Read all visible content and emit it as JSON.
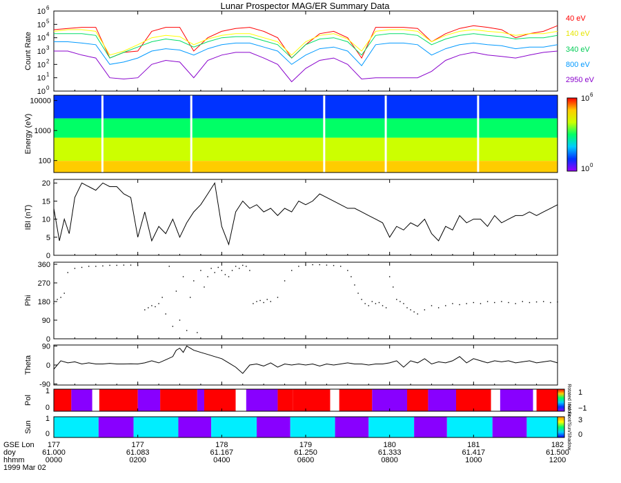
{
  "title": "Lunar Prospector MAG/ER Summary Data",
  "chart_data": [
    {
      "type": "line",
      "panel": "count_rate",
      "ylabel": "Count Rate",
      "yscale": "log",
      "ylim": [
        1,
        1000000
      ],
      "yticks": [
        "10",
        "10",
        "10",
        "10",
        "10",
        "10",
        "10"
      ],
      "ytick_exp": [
        "0",
        "1",
        "2",
        "3",
        "4",
        "5",
        "6"
      ],
      "grid": false,
      "legend_position": "right",
      "x": [
        0,
        20,
        40,
        60,
        80,
        100,
        120,
        140,
        160,
        180,
        200,
        220,
        240,
        260,
        280,
        300,
        320,
        340,
        360,
        380,
        400,
        420,
        440,
        460,
        480,
        500,
        520,
        540,
        560,
        580,
        600,
        620,
        640,
        660,
        680,
        700,
        720
      ],
      "series": [
        {
          "name": "40 eV",
          "color": "#ff0000",
          "values": [
            40000,
            50000,
            60000,
            60000,
            300,
            800,
            1000,
            30000,
            60000,
            60000,
            1000,
            10000,
            30000,
            50000,
            60000,
            30000,
            10000,
            300,
            3000,
            20000,
            30000,
            10000,
            300,
            60000,
            60000,
            60000,
            50000,
            5000,
            20000,
            50000,
            80000,
            60000,
            40000,
            10000,
            20000,
            30000,
            80000
          ]
        },
        {
          "name": "140 eV",
          "color": "#ffff00",
          "values": [
            30000,
            40000,
            40000,
            30000,
            500,
            1000,
            3000,
            10000,
            15000,
            12000,
            3000,
            8000,
            15000,
            20000,
            20000,
            10000,
            5000,
            500,
            5000,
            15000,
            20000,
            8000,
            1000,
            30000,
            40000,
            40000,
            30000,
            5000,
            15000,
            30000,
            40000,
            30000,
            25000,
            15000,
            20000,
            20000,
            30000
          ]
        },
        {
          "name": "340 eV",
          "color": "#00dd66",
          "values": [
            20000,
            20000,
            20000,
            15000,
            300,
            800,
            2000,
            5000,
            8000,
            6000,
            2000,
            5000,
            10000,
            12000,
            12000,
            6000,
            3000,
            300,
            3000,
            8000,
            10000,
            5000,
            500,
            15000,
            20000,
            20000,
            15000,
            3000,
            8000,
            15000,
            20000,
            15000,
            12000,
            8000,
            10000,
            10000,
            15000
          ]
        },
        {
          "name": "800 eV",
          "color": "#0099ff",
          "values": [
            5000,
            5000,
            4000,
            3000,
            100,
            150,
            300,
            1000,
            1500,
            1200,
            500,
            1500,
            3000,
            4000,
            4000,
            2000,
            1000,
            100,
            500,
            1500,
            2000,
            1000,
            80,
            3000,
            4000,
            4000,
            3000,
            500,
            1500,
            3000,
            4000,
            3000,
            2500,
            1500,
            2000,
            2000,
            3000
          ]
        },
        {
          "name": "2950 eV",
          "color": "#8800cc",
          "values": [
            1000,
            1000,
            500,
            300,
            10,
            8,
            10,
            100,
            200,
            150,
            10,
            200,
            500,
            800,
            800,
            300,
            100,
            5,
            50,
            200,
            300,
            100,
            8,
            10,
            10,
            10,
            10,
            30,
            200,
            500,
            800,
            500,
            400,
            300,
            500,
            800,
            1000
          ]
        }
      ]
    },
    {
      "type": "heatmap",
      "panel": "energy_spectrogram",
      "ylabel": "Energy (eV)",
      "yscale": "log",
      "ylim": [
        40,
        15000
      ],
      "yticks": [
        "10000",
        "1000",
        "100"
      ],
      "colorbar": {
        "min_label": "10",
        "min_exp": "0",
        "max_label": "10",
        "max_exp": "6",
        "colors": [
          "#9900ff",
          "#0033ff",
          "#00ccff",
          "#00ff66",
          "#ccff00",
          "#ffcc00",
          "#ff0000"
        ]
      },
      "gaps_x": [
        68,
        110,
        195,
        243,
        385,
        424,
        473,
        496,
        605,
        628
      ]
    },
    {
      "type": "line",
      "panel": "field_magnitude",
      "ylabel": "IBI (nT)",
      "ylim": [
        0,
        21
      ],
      "yticks": [
        "0",
        "5",
        "10",
        "15",
        "20"
      ],
      "ytick_values": [
        0,
        5,
        10,
        15,
        20
      ],
      "x": [
        0,
        8,
        15,
        22,
        30,
        40,
        50,
        60,
        70,
        80,
        90,
        100,
        110,
        120,
        130,
        140,
        150,
        160,
        170,
        180,
        190,
        200,
        210,
        220,
        230,
        240,
        250,
        260,
        270,
        280,
        290,
        300,
        310,
        320,
        330,
        340,
        350,
        360,
        370,
        380,
        390,
        400,
        410,
        420,
        430,
        440,
        450,
        460,
        470,
        480,
        490,
        500,
        510,
        520,
        530,
        540,
        550,
        560,
        570,
        580,
        590,
        600,
        610,
        620,
        630,
        640,
        650,
        660,
        670,
        680,
        690,
        700,
        710,
        720
      ],
      "values": [
        13,
        4,
        10,
        6,
        16,
        20,
        19,
        18,
        20,
        19,
        19,
        17,
        16,
        5,
        12,
        4,
        8,
        6,
        10,
        5,
        9,
        12,
        14,
        17,
        20,
        8,
        3,
        12,
        15,
        13,
        14,
        12,
        13,
        11,
        13,
        12,
        15,
        14,
        15,
        17,
        16,
        15,
        14,
        13,
        13,
        12,
        11,
        10,
        9,
        5,
        8,
        7,
        9,
        8,
        10,
        6,
        4,
        8,
        7,
        11,
        9,
        10,
        10,
        8,
        11,
        9,
        10,
        11,
        11,
        12,
        11,
        12,
        13,
        14
      ]
    },
    {
      "type": "scatter",
      "panel": "phi",
      "ylabel": "Phi",
      "ylim": [
        0,
        370
      ],
      "yticks": [
        "0",
        "90",
        "180",
        "270",
        "360"
      ],
      "ytick_values": [
        0,
        90,
        180,
        270,
        360
      ],
      "x": [
        0,
        5,
        10,
        15,
        20,
        30,
        40,
        50,
        60,
        70,
        80,
        90,
        100,
        110,
        120,
        130,
        135,
        140,
        145,
        150,
        155,
        160,
        165,
        170,
        175,
        180,
        185,
        190,
        195,
        200,
        205,
        210,
        215,
        220,
        225,
        230,
        235,
        240,
        245,
        250,
        255,
        260,
        265,
        270,
        275,
        280,
        285,
        290,
        295,
        300,
        305,
        310,
        320,
        330,
        340,
        350,
        360,
        370,
        380,
        390,
        400,
        410,
        420,
        425,
        430,
        435,
        440,
        445,
        450,
        455,
        460,
        465,
        470,
        475,
        480,
        485,
        490,
        495,
        500,
        505,
        510,
        515,
        520,
        530,
        540,
        550,
        560,
        570,
        580,
        590,
        600,
        610,
        620,
        630,
        640,
        650,
        660,
        670,
        680,
        690,
        700,
        710,
        720
      ],
      "values": [
        170,
        190,
        200,
        220,
        320,
        340,
        345,
        350,
        350,
        352,
        355,
        355,
        356,
        356,
        354,
        140,
        150,
        160,
        155,
        170,
        200,
        120,
        350,
        60,
        230,
        90,
        300,
        40,
        200,
        280,
        30,
        330,
        250,
        300,
        340,
        320,
        345,
        330,
        310,
        300,
        330,
        350,
        340,
        355,
        350,
        330,
        170,
        180,
        185,
        175,
        190,
        180,
        200,
        280,
        330,
        350,
        355,
        358,
        358,
        356,
        354,
        350,
        330,
        300,
        260,
        220,
        190,
        170,
        160,
        180,
        170,
        175,
        160,
        150,
        300,
        250,
        190,
        180,
        170,
        150,
        140,
        130,
        120,
        140,
        160,
        150,
        160,
        170,
        165,
        170,
        175,
        170,
        180,
        175,
        180,
        175,
        170,
        180,
        175,
        178,
        180,
        175,
        178
      ]
    },
    {
      "type": "line",
      "panel": "theta",
      "ylabel": "Theta",
      "ylim": [
        -95,
        95
      ],
      "yticks": [
        "-90",
        "0",
        "90"
      ],
      "ytick_values": [
        -90,
        0,
        90
      ],
      "x": [
        0,
        10,
        20,
        30,
        40,
        50,
        60,
        70,
        80,
        90,
        100,
        110,
        120,
        130,
        140,
        150,
        160,
        170,
        175,
        180,
        185,
        190,
        200,
        210,
        220,
        230,
        240,
        250,
        260,
        270,
        280,
        290,
        300,
        310,
        320,
        330,
        340,
        350,
        360,
        370,
        380,
        390,
        400,
        410,
        420,
        430,
        440,
        450,
        460,
        470,
        480,
        490,
        500,
        510,
        520,
        530,
        540,
        550,
        560,
        570,
        580,
        590,
        600,
        610,
        620,
        630,
        640,
        650,
        660,
        670,
        680,
        690,
        700,
        710,
        720
      ],
      "values": [
        -20,
        20,
        10,
        15,
        5,
        10,
        5,
        5,
        8,
        5,
        5,
        6,
        5,
        10,
        20,
        10,
        25,
        40,
        70,
        80,
        60,
        90,
        70,
        60,
        50,
        40,
        30,
        10,
        -10,
        -40,
        0,
        5,
        -5,
        10,
        -10,
        5,
        0,
        5,
        0,
        5,
        -5,
        5,
        0,
        5,
        10,
        5,
        5,
        0,
        5,
        5,
        10,
        20,
        -10,
        20,
        10,
        30,
        5,
        15,
        10,
        20,
        40,
        10,
        30,
        20,
        10,
        20,
        15,
        20,
        10,
        15,
        20,
        10,
        15,
        20,
        10
      ]
    },
    {
      "type": "heatmap",
      "panel": "polarity",
      "ylabel": "Pol",
      "yticks": [
        "0",
        "1"
      ],
      "colorbar": {
        "labels": [
          "1",
          "−1"
        ],
        "side_label": "Rotated Inc/out"
      },
      "segments": [
        {
          "x0": 0,
          "x1": 25,
          "v": 1,
          "color": "#ff0000"
        },
        {
          "x0": 25,
          "x1": 55,
          "v": -1,
          "color": "#8800ff"
        },
        {
          "x0": 55,
          "x1": 65,
          "v": 0,
          "color": "#ffffff"
        },
        {
          "x0": 65,
          "x1": 120,
          "v": 1,
          "color": "#ff0000"
        },
        {
          "x0": 120,
          "x1": 152,
          "v": -1,
          "color": "#8800ff"
        },
        {
          "x0": 152,
          "x1": 205,
          "v": 1,
          "color": "#ff0000"
        },
        {
          "x0": 205,
          "x1": 215,
          "v": -1,
          "color": "#8800ff"
        },
        {
          "x0": 215,
          "x1": 260,
          "v": 1,
          "color": "#ff0000"
        },
        {
          "x0": 260,
          "x1": 275,
          "v": 0,
          "color": "#ffffff"
        },
        {
          "x0": 275,
          "x1": 320,
          "v": -1,
          "color": "#8800ff"
        },
        {
          "x0": 320,
          "x1": 342,
          "v": 1,
          "color": "#ff0000"
        },
        {
          "x0": 342,
          "x1": 395,
          "v": 1,
          "color": "#ff0000"
        },
        {
          "x0": 395,
          "x1": 408,
          "v": 0,
          "color": "#ffffff"
        },
        {
          "x0": 408,
          "x1": 455,
          "v": 1,
          "color": "#ff0000"
        },
        {
          "x0": 455,
          "x1": 505,
          "v": -1,
          "color": "#8800ff"
        },
        {
          "x0": 505,
          "x1": 535,
          "v": 1,
          "color": "#ff0000"
        },
        {
          "x0": 535,
          "x1": 575,
          "v": -1,
          "color": "#8800ff"
        },
        {
          "x0": 575,
          "x1": 625,
          "v": 1,
          "color": "#ff0000"
        },
        {
          "x0": 625,
          "x1": 638,
          "v": 0,
          "color": "#ffffff"
        },
        {
          "x0": 638,
          "x1": 685,
          "v": -1,
          "color": "#8800ff"
        },
        {
          "x0": 685,
          "x1": 690,
          "v": 0,
          "color": "#ffffff"
        },
        {
          "x0": 690,
          "x1": 730,
          "v": 1,
          "color": "#ff0000"
        }
      ]
    },
    {
      "type": "heatmap",
      "panel": "sun",
      "ylabel": "Sun",
      "yticks": [
        "0",
        "1"
      ],
      "colorbar": {
        "labels": [
          "3",
          "0"
        ],
        "side_label": "No Foot/Sun/Shadow"
      },
      "segments": [
        {
          "x0": 0,
          "x1": 64,
          "v": 3,
          "color": "#00eeff"
        },
        {
          "x0": 64,
          "x1": 114,
          "v": 0,
          "color": "#8800ff"
        },
        {
          "x0": 114,
          "x1": 178,
          "v": 3,
          "color": "#00eeff"
        },
        {
          "x0": 178,
          "x1": 225,
          "v": 0,
          "color": "#8800ff"
        },
        {
          "x0": 225,
          "x1": 290,
          "v": 3,
          "color": "#00eeff"
        },
        {
          "x0": 290,
          "x1": 338,
          "v": 0,
          "color": "#8800ff"
        },
        {
          "x0": 338,
          "x1": 402,
          "v": 3,
          "color": "#00eeff"
        },
        {
          "x0": 402,
          "x1": 450,
          "v": 0,
          "color": "#8800ff"
        },
        {
          "x0": 450,
          "x1": 515,
          "v": 3,
          "color": "#00eeff"
        },
        {
          "x0": 515,
          "x1": 562,
          "v": 0,
          "color": "#8800ff"
        },
        {
          "x0": 562,
          "x1": 627,
          "v": 3,
          "color": "#00eeff"
        },
        {
          "x0": 627,
          "x1": 676,
          "v": 0,
          "color": "#8800ff"
        },
        {
          "x0": 676,
          "x1": 730,
          "v": 3,
          "color": "#00eeff"
        }
      ]
    }
  ],
  "x_axis": {
    "row_labels": [
      "GSE Lon",
      "doy",
      "hhmm"
    ],
    "date": "1999 Mar 02",
    "ticks": [
      {
        "lon": "177",
        "doy": "61.000",
        "hhmm": "0000"
      },
      {
        "lon": "177",
        "doy": "61.083",
        "hhmm": "0200"
      },
      {
        "lon": "178",
        "doy": "61.167",
        "hhmm": "0400"
      },
      {
        "lon": "179",
        "doy": "61.250",
        "hhmm": "0600"
      },
      {
        "lon": "180",
        "doy": "61.333",
        "hhmm": "0800"
      },
      {
        "lon": "181",
        "doy": "61.417",
        "hhmm": "1000"
      },
      {
        "lon": "182",
        "doy": "61.500",
        "hhmm": "1200"
      }
    ]
  }
}
